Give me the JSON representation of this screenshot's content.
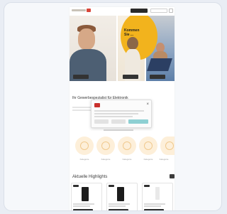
{
  "page": {
    "section_title": "Ihr Gewerbespezialist für Elektronik",
    "highlights_title": "Aktuelle Highlights",
    "hero": {
      "heading": "Kommen Sie ..."
    },
    "categories": [
      "Kategorie",
      "Kategorie",
      "Kategorie",
      "Kategorie",
      "Kategorie"
    ],
    "products": [
      {
        "name": "Produkt 1"
      },
      {
        "name": "Produkt 2"
      },
      {
        "name": "Produkt 3"
      }
    ]
  },
  "colors": {
    "accent_yellow": "#f2b31d",
    "brand_red": "#d8463a",
    "teal": "#8ed0d3"
  }
}
